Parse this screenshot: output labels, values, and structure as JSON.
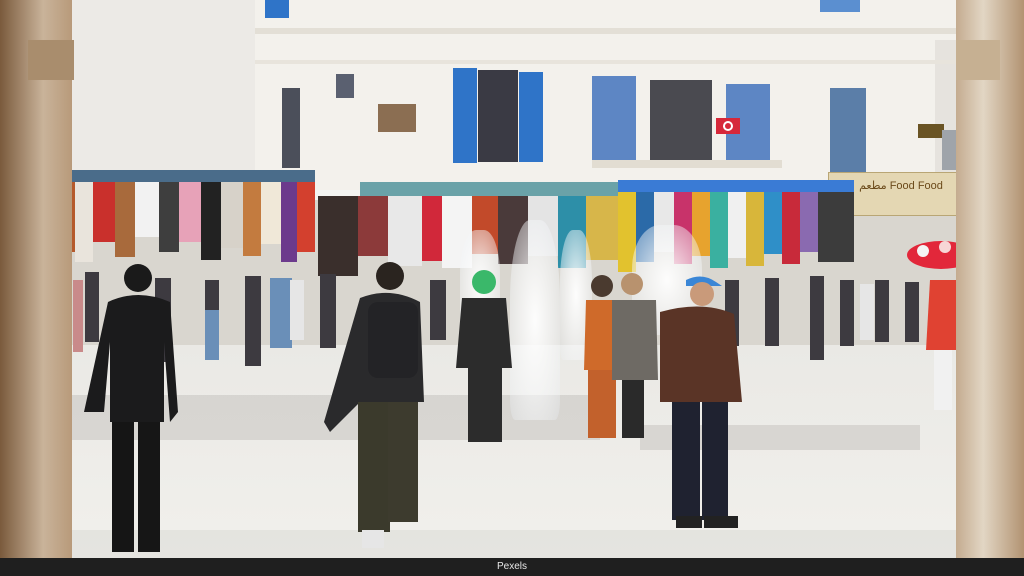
{
  "image": {
    "scene": "street market square with fountain and pedestrians",
    "watermark": "Pexels",
    "shop_sign_text": "ﻣﻄﻌﻢ Food Food"
  },
  "colors": {
    "shutter_blue": "#2f74c8",
    "awning_blue": "#3a7bd5",
    "stone_arch": "#c9b39a",
    "pavement": "#eceae6",
    "footer": "#1f1f1f"
  }
}
